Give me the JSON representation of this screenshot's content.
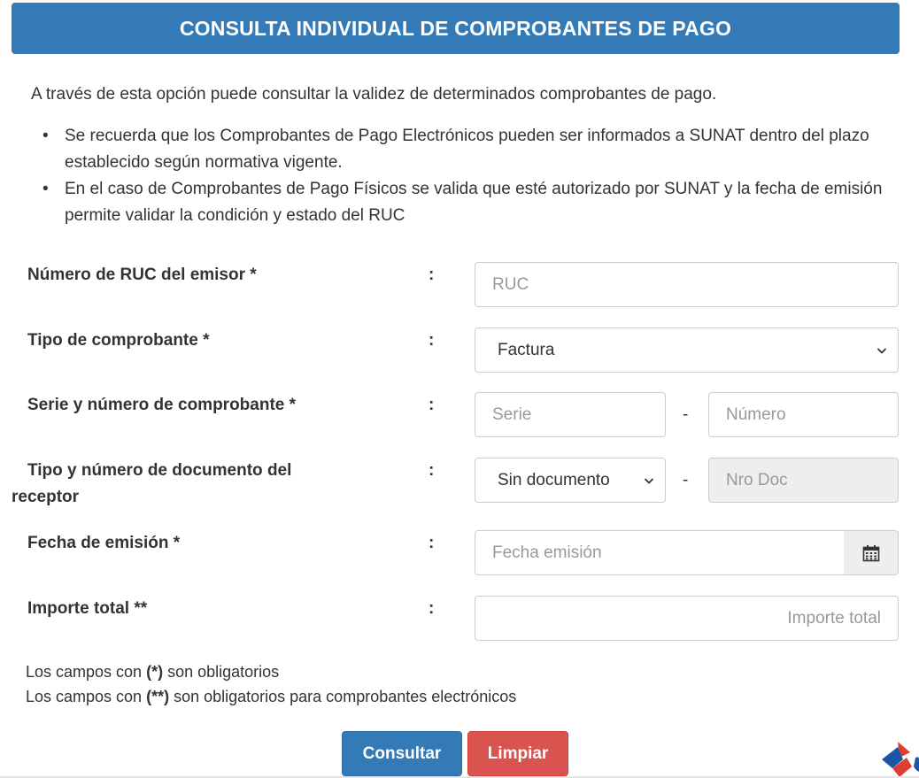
{
  "header": {
    "title": "CONSULTA INDIVIDUAL DE COMPROBANTES DE PAGO"
  },
  "intro": "A través de esta opción puede consultar la validez de determinados comprobantes de pago.",
  "bullets": [
    "Se recuerda que los Comprobantes de Pago Electrónicos pueden ser informados a SUNAT dentro del plazo establecido según normativa vigente.",
    "En el caso de Comprobantes de Pago Físicos se valida que esté autorizado por SUNAT y la fecha de emisión permite validar la condición y estado del RUC"
  ],
  "form": {
    "colon": ":",
    "separator": "-",
    "ruc": {
      "label": "Número de RUC del emisor *",
      "placeholder": "RUC"
    },
    "tipo_comprobante": {
      "label": "Tipo de comprobante *",
      "selected": "Factura"
    },
    "serie_numero": {
      "label": "Serie y número de comprobante *",
      "serie_placeholder": "Serie",
      "numero_placeholder": "Número"
    },
    "documento_receptor": {
      "label_line1": "Tipo y número de documento del",
      "label_line2": "receptor",
      "selected": "Sin documento",
      "nro_placeholder": "Nro Doc"
    },
    "fecha_emision": {
      "label": "Fecha de emisión *",
      "placeholder": "Fecha emisión",
      "icon": "calendar-icon"
    },
    "importe_total": {
      "label": "Importe total **",
      "placeholder": "Importe total"
    }
  },
  "notes": {
    "required_prefix": "Los campos con ",
    "required_mark": "(*)",
    "required_suffix": " son obligatorios",
    "electronic_prefix": "Los campos con ",
    "electronic_mark": "(**)",
    "electronic_suffix": " son obligatorios para comprobantes electrónicos"
  },
  "buttons": {
    "consultar": "Consultar",
    "limpiar": "Limpiar"
  },
  "colors": {
    "primary": "#337ab7",
    "danger": "#d9534f",
    "logo_blue": "#1a56a8",
    "logo_red": "#e03c31"
  }
}
